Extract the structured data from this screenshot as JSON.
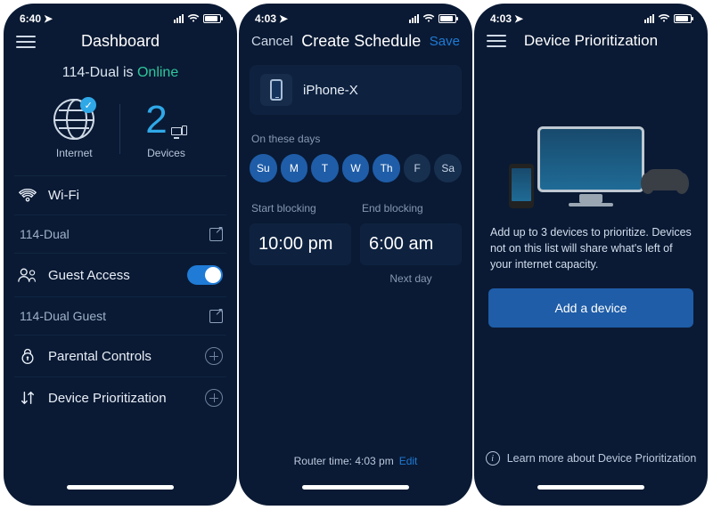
{
  "screen1": {
    "time": "6:40",
    "title": "Dashboard",
    "network_status_prefix": "114-Dual is ",
    "network_status_word": "Online",
    "internet_label": "Internet",
    "devices_count": "2",
    "devices_label": "Devices",
    "wifi_label": "Wi-Fi",
    "wifi_name": "114-Dual",
    "guest_label": "Guest Access",
    "guest_name": "114-Dual Guest",
    "parental_label": "Parental Controls",
    "prioritization_label": "Device Prioritization"
  },
  "screen2": {
    "time": "4:03",
    "cancel": "Cancel",
    "title": "Create Schedule",
    "save": "Save",
    "device_name": "iPhone-X",
    "days_label": "On these days",
    "days": [
      {
        "abbr": "Su",
        "selected": true
      },
      {
        "abbr": "M",
        "selected": true
      },
      {
        "abbr": "T",
        "selected": true
      },
      {
        "abbr": "W",
        "selected": true
      },
      {
        "abbr": "Th",
        "selected": true
      },
      {
        "abbr": "F",
        "selected": false
      },
      {
        "abbr": "Sa",
        "selected": false
      }
    ],
    "start_label": "Start blocking",
    "start_time": "10:00 pm",
    "end_label": "End blocking",
    "end_time": "6:00 am",
    "next_day": "Next day",
    "router_time_prefix": "Router time: ",
    "router_time": "4:03 pm",
    "edit": "Edit"
  },
  "screen3": {
    "time": "4:03",
    "title": "Device Prioritization",
    "description": "Add up to 3 devices to prioritize. Devices not on this list will share what's left of your internet capacity.",
    "add_button": "Add a device",
    "learn_more": "Learn more about Device Prioritization"
  }
}
